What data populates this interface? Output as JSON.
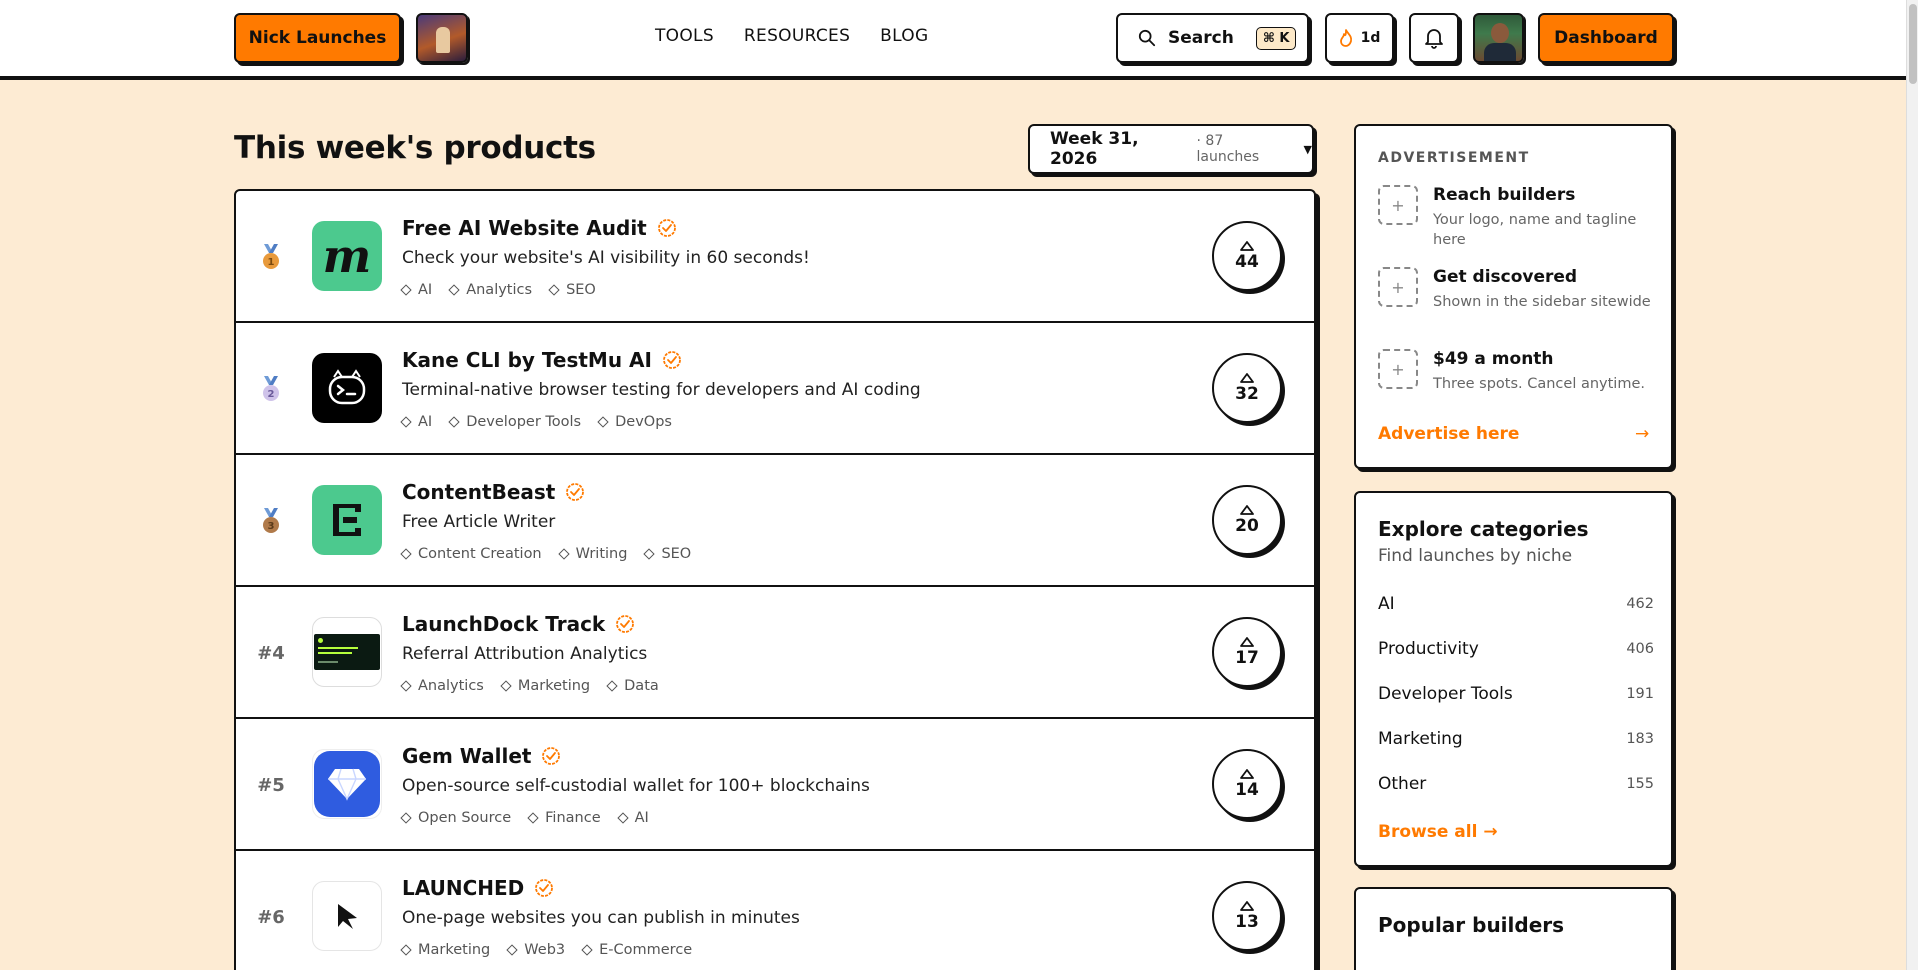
{
  "header": {
    "brand_label": "Nick Launches",
    "nav": [
      "TOOLS",
      "RESOURCES",
      "BLOG"
    ],
    "search_label": "Search",
    "search_kbd": "⌘ K",
    "streak_label": "1d",
    "dashboard_label": "Dashboard"
  },
  "main": {
    "title": "This week's products",
    "week": {
      "label": "Week 31, 2026",
      "sub": "· 87 launches"
    },
    "products": [
      {
        "rank": "1",
        "name": "Free AI Website Audit",
        "tagline": "Check your website's AI visibility in 60 seconds!",
        "tags": [
          "AI",
          "Analytics",
          "SEO"
        ],
        "votes": "44",
        "medal_color": "#e89a3c"
      },
      {
        "rank": "2",
        "name": "Kane CLI by TestMu AI",
        "tagline": "Terminal-native browser testing for developers and AI coding",
        "tags": [
          "AI",
          "Developer Tools",
          "DevOps"
        ],
        "votes": "32",
        "medal_color": "#b7a7d9"
      },
      {
        "rank": "3",
        "name": "ContentBeast",
        "tagline": "Free Article Writer",
        "tags": [
          "Content Creation",
          "Writing",
          "SEO"
        ],
        "votes": "20",
        "medal_color": "#b07a4a"
      },
      {
        "rank": "#4",
        "name": "LaunchDock Track",
        "tagline": "Referral Attribution Analytics",
        "tags": [
          "Analytics",
          "Marketing",
          "Data"
        ],
        "votes": "17"
      },
      {
        "rank": "#5",
        "name": "Gem Wallet",
        "tagline": "Open-source self-custodial wallet for 100+ blockchains",
        "tags": [
          "Open Source",
          "Finance",
          "AI"
        ],
        "votes": "14"
      },
      {
        "rank": "#6",
        "name": "LAUNCHED",
        "tagline": "One-page websites you can publish in minutes",
        "tags": [
          "Marketing",
          "Web3",
          "E-Commerce"
        ],
        "votes": "13"
      }
    ],
    "logo_text": {
      "free_ai": "m"
    }
  },
  "sidebar": {
    "ad": {
      "label": "ADVERTISEMENT",
      "items": [
        {
          "title": "Reach builders",
          "sub": "Your logo, name and tagline here"
        },
        {
          "title": "Get discovered",
          "sub": "Shown in the sidebar sitewide"
        },
        {
          "title": "$49 a month",
          "sub": "Three spots. Cancel anytime."
        }
      ],
      "link": "Advertise here"
    },
    "categories": {
      "title": "Explore categories",
      "sub": "Find launches by niche",
      "items": [
        {
          "name": "AI",
          "count": "462"
        },
        {
          "name": "Productivity",
          "count": "406"
        },
        {
          "name": "Developer Tools",
          "count": "191"
        },
        {
          "name": "Marketing",
          "count": "183"
        },
        {
          "name": "Other",
          "count": "155"
        }
      ],
      "browse": "Browse all →"
    },
    "popular": {
      "title": "Popular builders"
    }
  },
  "colors": {
    "accent": "#ff7a00",
    "background": "#fdebd3"
  }
}
